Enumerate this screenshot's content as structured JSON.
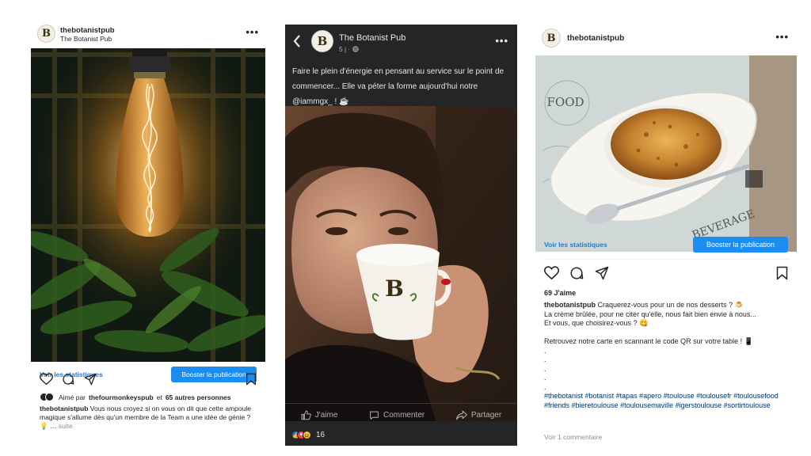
{
  "post1": {
    "username": "thebotanistpub",
    "subtitle": "The Botanist Pub",
    "avatar_letter": "B",
    "more_icon": "three-dots-icon",
    "stats_link": "Voir les statistiques",
    "boost_button": "Booster la publication",
    "liked_prefix": "Aimé par",
    "liked_user": "thefourmonkeyspub",
    "liked_middle": "et",
    "liked_others": "65 autres personnes",
    "caption_user": "thebotanistpub",
    "caption_text": "Vous nous croyez si on vous on dit que cette ampoule magique s'allume dès qu'un membre de la Team a une idée de génie ? 💡 …",
    "caption_more": "suite"
  },
  "post2": {
    "page_name": "The Botanist Pub",
    "avatar_letter": "B",
    "time": "5 j ·",
    "text": "Faire le plein d'énergie en pensant au service sur le point de commencer... Elle va péter la forme aujourd'hui notre @iammgx_ ! ☕",
    "cup_letter": "B",
    "like_label": "J'aime",
    "comment_label": "Commenter",
    "share_label": "Partager",
    "reaction_count": "16"
  },
  "post3": {
    "username": "thebotanistpub",
    "avatar_letter": "B",
    "stats_link": "Voir les statistiques",
    "boost_button": "Booster la publication",
    "likes": "69 J'aime",
    "caption_user": "thebotanistpub",
    "caption_lines": [
      "Craquerez-vous pour un de nos desserts ? 🍮",
      "La crème brûlée, pour ne citer qu'elle, nous fait bien envie à nous...",
      "Et vous, que choisirez-vous ? 😋",
      "",
      "Retrouvez notre carte en scannant le code QR sur votre table ! 📱",
      ".",
      ".",
      ".",
      ".",
      "."
    ],
    "hashtags": "#thebotanist #botanist #tapas #apero #toulouse #toulousefr #toulousefood #friends #bieretoulouse #toulousemaville #igerstoulouse #sortirtoulouse",
    "comments": "Voir 1 commentaire",
    "menu_text_1": "FOOD",
    "menu_text_2": "BEVERAGE"
  },
  "colors": {
    "ig_link": "#1e7bd0",
    "boost_bg": "#1b8cf0",
    "fb_bg": "#242526",
    "fb_text": "#e4e6eb",
    "fb_muted": "#b0b3b8"
  }
}
